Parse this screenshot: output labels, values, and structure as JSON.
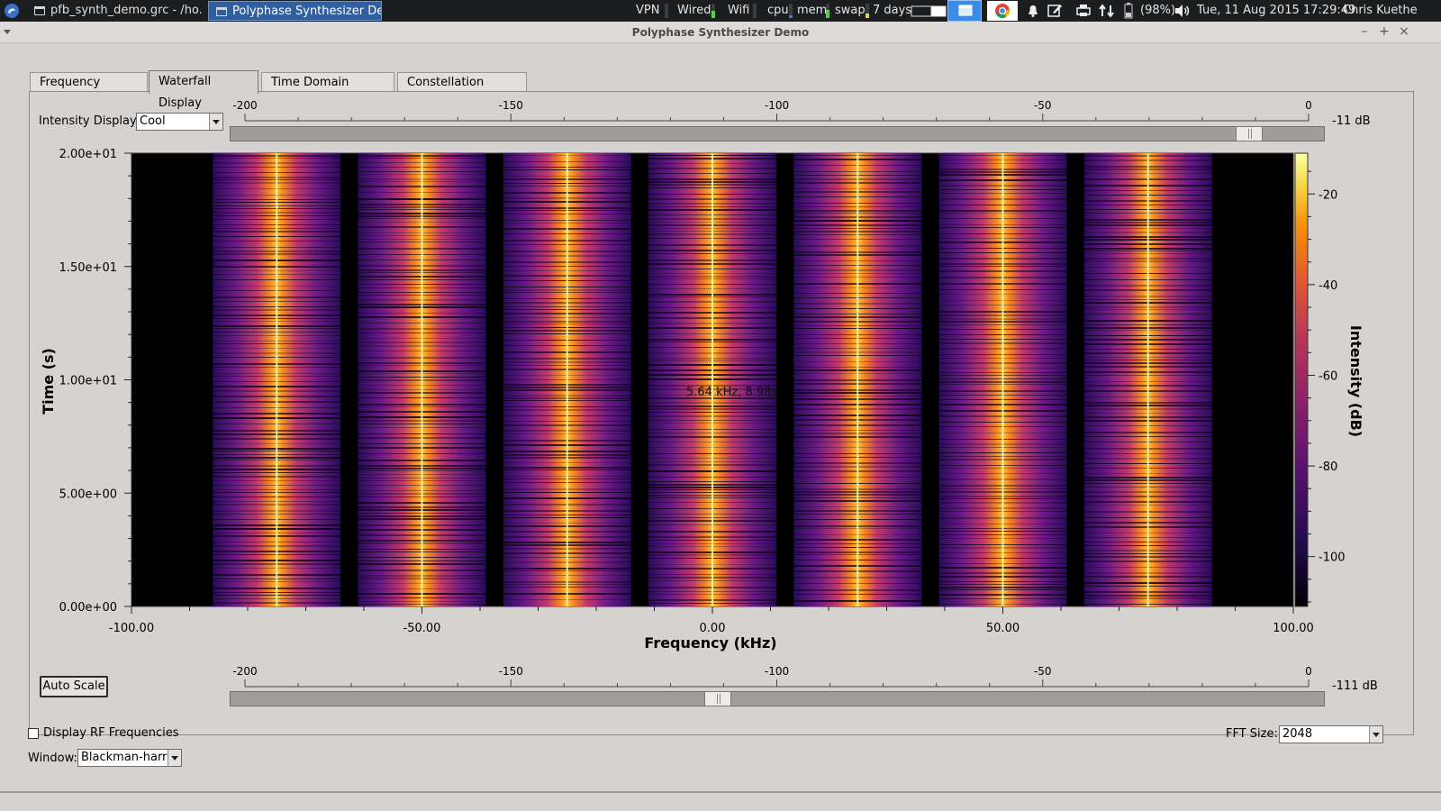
{
  "taskbar": {
    "tasks": [
      {
        "label": "pfb_synth_demo.grc - /ho...",
        "active": false
      },
      {
        "label": "Polyphase Synthesizer De...",
        "active": true
      }
    ],
    "indicators": {
      "vpn": "VPN",
      "wired": "Wired",
      "wifi": "Wifi",
      "cpu": "cpu",
      "mem": "mem",
      "swap": "swap",
      "uptime": "7 days",
      "battery": "(98%)",
      "datetime": "Tue, 11 Aug 2015 17:29:49",
      "user": "Chris Kuethe"
    }
  },
  "window": {
    "title": "Polyphase Synthesizer Demo",
    "minimize": "–",
    "maximize": "+",
    "close": "×"
  },
  "tabs": [
    {
      "label": "Frequency Display",
      "active": false
    },
    {
      "label": "Waterfall Display",
      "active": true
    },
    {
      "label": "Time Domain Display",
      "active": false
    },
    {
      "label": "Constellation Display",
      "active": false
    }
  ],
  "controls": {
    "intensity_label": "Intensity Display:",
    "intensity_value": "Cool",
    "top_slider": {
      "ticks": [
        "-200",
        "-150",
        "-100",
        "-50",
        "0"
      ],
      "value_label": "-11 dB",
      "min": -200,
      "max": 0,
      "value": -11
    },
    "bottom_slider": {
      "ticks": [
        "-200",
        "-150",
        "-100",
        "-50",
        "0"
      ],
      "value_label": "-111 dB",
      "min": -200,
      "max": 0,
      "value": -111
    },
    "auto_scale": "Auto Scale",
    "rf_checkbox_label": "Display RF Frequencies",
    "rf_checked": false,
    "fft_label": "FFT Size:",
    "fft_value": "2048",
    "window_label": "Window:",
    "window_value": "Blackman-harris"
  },
  "waterfall": {
    "cursor_text": "5.64 kHz, 8.98s",
    "xlabel": "Frequency (kHz)",
    "ylabel": "Time (s)",
    "colorbar_label": "Intensity (dB)",
    "x_ticks": [
      "-100.00",
      "-50.00",
      "0.00",
      "50.00",
      "100.00"
    ],
    "y_ticks": [
      "0.00e+00",
      "5.00e+00",
      "1.00e+01",
      "1.50e+01",
      "2.00e+01"
    ],
    "colorbar_ticks": [
      "-20",
      "-40",
      "-60",
      "-80",
      "-100"
    ],
    "x_range": [
      -100,
      100
    ],
    "y_range": [
      0,
      20
    ],
    "intensity_range": [
      -111,
      -11
    ],
    "channel_centers_khz": [
      -75,
      -50,
      -25,
      0,
      25,
      50,
      75
    ],
    "channel_half_width_khz": 11
  }
}
